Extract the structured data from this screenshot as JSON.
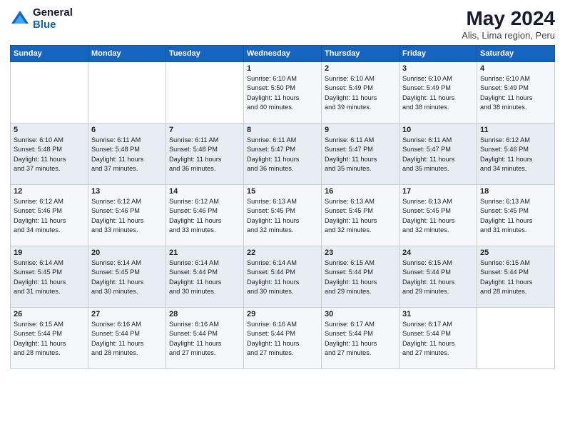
{
  "logo": {
    "general": "General",
    "blue": "Blue"
  },
  "title": {
    "month": "May 2024",
    "location": "Alis, Lima region, Peru"
  },
  "days_of_week": [
    "Sunday",
    "Monday",
    "Tuesday",
    "Wednesday",
    "Thursday",
    "Friday",
    "Saturday"
  ],
  "weeks": [
    [
      {
        "day": "",
        "info": ""
      },
      {
        "day": "",
        "info": ""
      },
      {
        "day": "",
        "info": ""
      },
      {
        "day": "1",
        "info": "Sunrise: 6:10 AM\nSunset: 5:50 PM\nDaylight: 11 hours\nand 40 minutes."
      },
      {
        "day": "2",
        "info": "Sunrise: 6:10 AM\nSunset: 5:49 PM\nDaylight: 11 hours\nand 39 minutes."
      },
      {
        "day": "3",
        "info": "Sunrise: 6:10 AM\nSunset: 5:49 PM\nDaylight: 11 hours\nand 38 minutes."
      },
      {
        "day": "4",
        "info": "Sunrise: 6:10 AM\nSunset: 5:49 PM\nDaylight: 11 hours\nand 38 minutes."
      }
    ],
    [
      {
        "day": "5",
        "info": "Sunrise: 6:10 AM\nSunset: 5:48 PM\nDaylight: 11 hours\nand 37 minutes."
      },
      {
        "day": "6",
        "info": "Sunrise: 6:11 AM\nSunset: 5:48 PM\nDaylight: 11 hours\nand 37 minutes."
      },
      {
        "day": "7",
        "info": "Sunrise: 6:11 AM\nSunset: 5:48 PM\nDaylight: 11 hours\nand 36 minutes."
      },
      {
        "day": "8",
        "info": "Sunrise: 6:11 AM\nSunset: 5:47 PM\nDaylight: 11 hours\nand 36 minutes."
      },
      {
        "day": "9",
        "info": "Sunrise: 6:11 AM\nSunset: 5:47 PM\nDaylight: 11 hours\nand 35 minutes."
      },
      {
        "day": "10",
        "info": "Sunrise: 6:11 AM\nSunset: 5:47 PM\nDaylight: 11 hours\nand 35 minutes."
      },
      {
        "day": "11",
        "info": "Sunrise: 6:12 AM\nSunset: 5:46 PM\nDaylight: 11 hours\nand 34 minutes."
      }
    ],
    [
      {
        "day": "12",
        "info": "Sunrise: 6:12 AM\nSunset: 5:46 PM\nDaylight: 11 hours\nand 34 minutes."
      },
      {
        "day": "13",
        "info": "Sunrise: 6:12 AM\nSunset: 5:46 PM\nDaylight: 11 hours\nand 33 minutes."
      },
      {
        "day": "14",
        "info": "Sunrise: 6:12 AM\nSunset: 5:46 PM\nDaylight: 11 hours\nand 33 minutes."
      },
      {
        "day": "15",
        "info": "Sunrise: 6:13 AM\nSunset: 5:45 PM\nDaylight: 11 hours\nand 32 minutes."
      },
      {
        "day": "16",
        "info": "Sunrise: 6:13 AM\nSunset: 5:45 PM\nDaylight: 11 hours\nand 32 minutes."
      },
      {
        "day": "17",
        "info": "Sunrise: 6:13 AM\nSunset: 5:45 PM\nDaylight: 11 hours\nand 32 minutes."
      },
      {
        "day": "18",
        "info": "Sunrise: 6:13 AM\nSunset: 5:45 PM\nDaylight: 11 hours\nand 31 minutes."
      }
    ],
    [
      {
        "day": "19",
        "info": "Sunrise: 6:14 AM\nSunset: 5:45 PM\nDaylight: 11 hours\nand 31 minutes."
      },
      {
        "day": "20",
        "info": "Sunrise: 6:14 AM\nSunset: 5:45 PM\nDaylight: 11 hours\nand 30 minutes."
      },
      {
        "day": "21",
        "info": "Sunrise: 6:14 AM\nSunset: 5:44 PM\nDaylight: 11 hours\nand 30 minutes."
      },
      {
        "day": "22",
        "info": "Sunrise: 6:14 AM\nSunset: 5:44 PM\nDaylight: 11 hours\nand 30 minutes."
      },
      {
        "day": "23",
        "info": "Sunrise: 6:15 AM\nSunset: 5:44 PM\nDaylight: 11 hours\nand 29 minutes."
      },
      {
        "day": "24",
        "info": "Sunrise: 6:15 AM\nSunset: 5:44 PM\nDaylight: 11 hours\nand 29 minutes."
      },
      {
        "day": "25",
        "info": "Sunrise: 6:15 AM\nSunset: 5:44 PM\nDaylight: 11 hours\nand 28 minutes."
      }
    ],
    [
      {
        "day": "26",
        "info": "Sunrise: 6:15 AM\nSunset: 5:44 PM\nDaylight: 11 hours\nand 28 minutes."
      },
      {
        "day": "27",
        "info": "Sunrise: 6:16 AM\nSunset: 5:44 PM\nDaylight: 11 hours\nand 28 minutes."
      },
      {
        "day": "28",
        "info": "Sunrise: 6:16 AM\nSunset: 5:44 PM\nDaylight: 11 hours\nand 27 minutes."
      },
      {
        "day": "29",
        "info": "Sunrise: 6:16 AM\nSunset: 5:44 PM\nDaylight: 11 hours\nand 27 minutes."
      },
      {
        "day": "30",
        "info": "Sunrise: 6:17 AM\nSunset: 5:44 PM\nDaylight: 11 hours\nand 27 minutes."
      },
      {
        "day": "31",
        "info": "Sunrise: 6:17 AM\nSunset: 5:44 PM\nDaylight: 11 hours\nand 27 minutes."
      },
      {
        "day": "",
        "info": ""
      }
    ]
  ]
}
